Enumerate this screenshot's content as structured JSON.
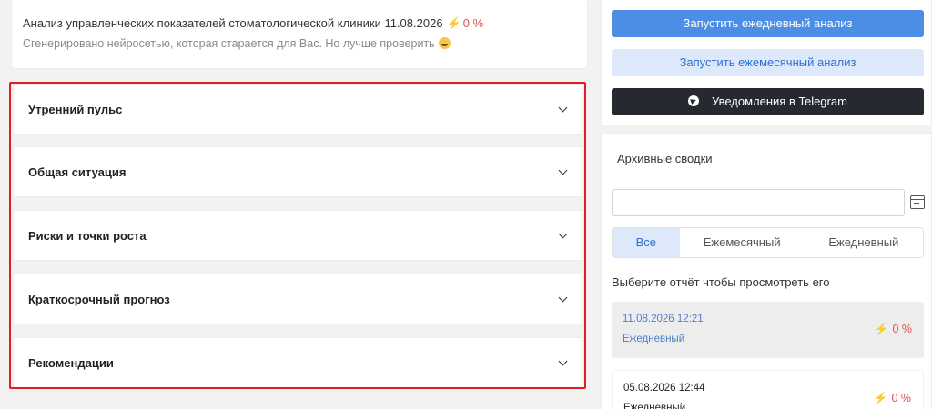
{
  "header": {
    "title": "Анализ управленческих показателей стоматологической клиники 11.08.2026",
    "percent": "0 %",
    "bolt_icon": "lightning-icon",
    "subtitle": "Сгенерировано нейросетью, которая старается для Вас. Но лучше проверить",
    "emoji_icon": "grinning-face-emoji-icon"
  },
  "sections": [
    {
      "label": "Утренний пульс"
    },
    {
      "label": "Общая ситуация"
    },
    {
      "label": "Риски и точки роста"
    },
    {
      "label": "Краткосрочный прогноз"
    },
    {
      "label": "Рекомендации"
    }
  ],
  "actions": {
    "daily_label": "Запустить ежедневный анализ",
    "monthly_label": "Запустить ежемесячный анализ",
    "telegram_label": "Уведомления в Telegram",
    "telegram_icon": "telegram-icon"
  },
  "archive": {
    "title": "Архивные сводки",
    "date_value": "",
    "calendar_icon": "calendar-icon",
    "filters": [
      "Все",
      "Ежемесячный",
      "Ежедневный"
    ],
    "active_filter": "Все",
    "hint": "Выберите отчёт чтобы просмотреть его",
    "reports": [
      {
        "date": "11.08.2026 12:21",
        "type": "Ежедневный",
        "percent": "0 %",
        "selected": true
      },
      {
        "date": "05.08.2026 12:44",
        "type": "Ежедневный",
        "percent": "0 %",
        "selected": false
      }
    ]
  },
  "colors": {
    "accent": "#4c8ee6",
    "accent_light": "#dde9fb",
    "dark_button": "#262a30",
    "danger": "#e05050",
    "highlight_border": "#e31b23"
  }
}
